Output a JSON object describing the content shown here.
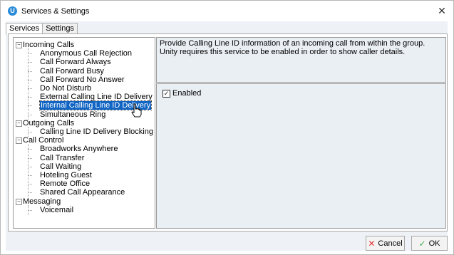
{
  "window": {
    "title": "Services & Settings",
    "app_icon_letter": "U"
  },
  "tabs": [
    {
      "label": "Services",
      "active": true
    },
    {
      "label": "Settings",
      "active": false
    }
  ],
  "tree": {
    "groups": [
      {
        "label": "Incoming Calls",
        "items": [
          "Anonymous Call Rejection",
          "Call Forward Always",
          "Call Forward Busy",
          "Call Forward No Answer",
          "Do Not Disturb",
          "External Calling Line ID Delivery",
          "Internal Calling Line ID Delivery",
          "Simultaneous Ring"
        ]
      },
      {
        "label": "Outgoing Calls",
        "items": [
          "Calling Line ID Delivery Blocking"
        ]
      },
      {
        "label": "Call Control",
        "items": [
          "Broadworks Anywhere",
          "Call Transfer",
          "Call Waiting",
          "Hoteling Guest",
          "Remote Office",
          "Shared Call Appearance"
        ]
      },
      {
        "label": "Messaging",
        "items": [
          "Voicemail"
        ]
      }
    ],
    "selected": "Internal Calling Line ID Delivery"
  },
  "description": "Provide Calling Line ID information of an incoming call from within the group.  Unity requires this service to be enabled in order to show caller details.",
  "detail": {
    "enabled_label": "Enabled",
    "enabled_checked": true
  },
  "buttons": {
    "cancel_label": "Cancel",
    "ok_label": "OK"
  },
  "colors": {
    "selection": "#0f64c4",
    "panel_bg": "#eaeff3",
    "app_icon": "#2a8bd8"
  }
}
